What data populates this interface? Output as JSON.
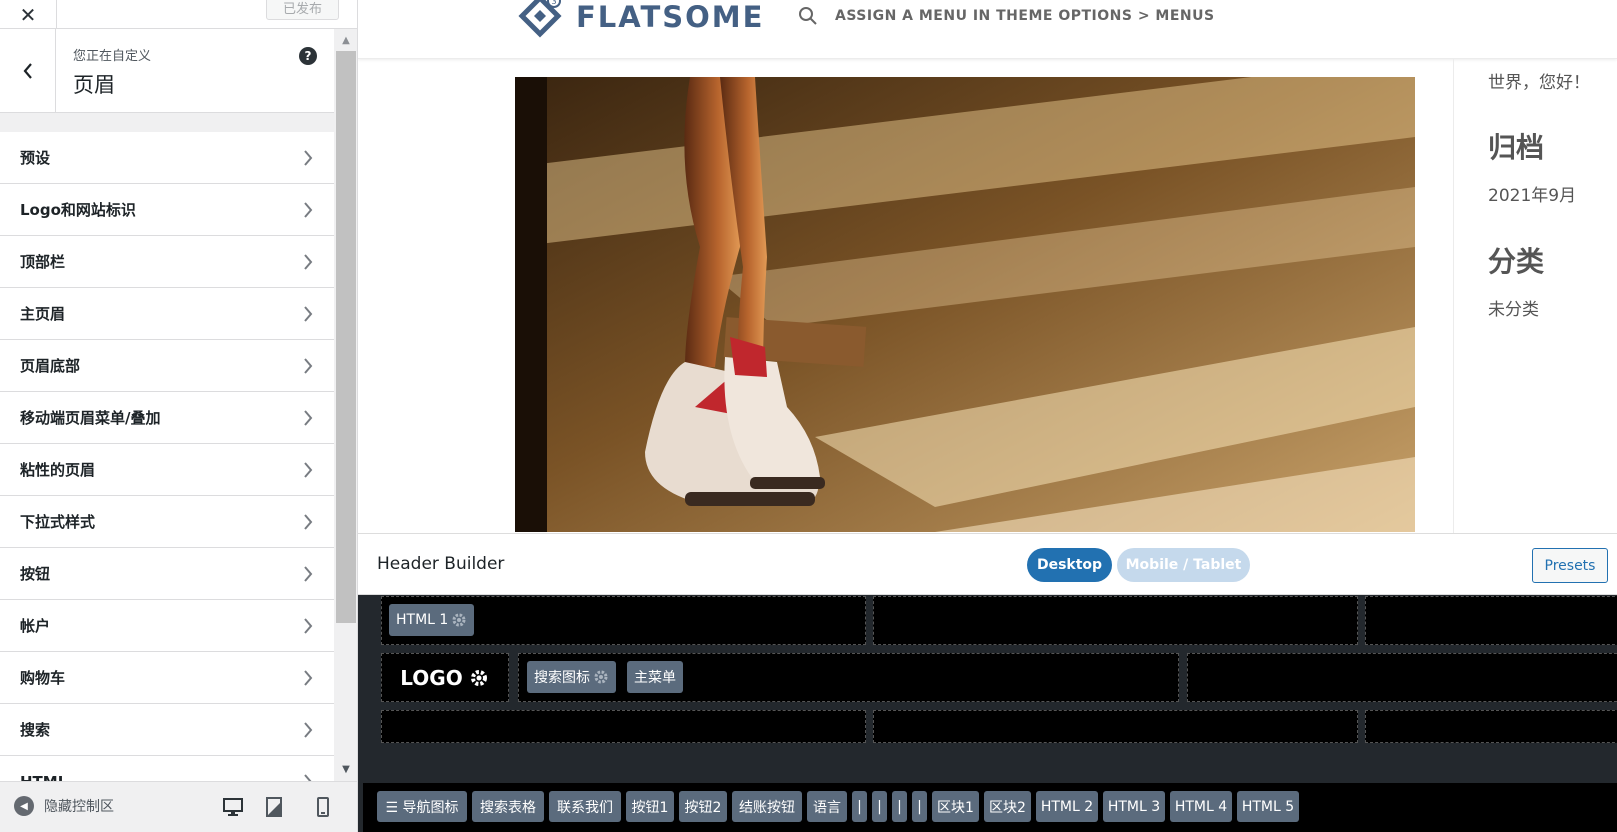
{
  "customizer": {
    "close_label": "✕",
    "publish_label": "已发布",
    "customizing_label": "您正在自定义",
    "section_title": "页眉",
    "help_label": "?",
    "menu_items": [
      {
        "label": "预设"
      },
      {
        "label": "Logo和网站标识"
      },
      {
        "label": "顶部栏"
      },
      {
        "label": "主页眉"
      },
      {
        "label": "页眉底部"
      },
      {
        "label": "移动端页眉菜单/叠加"
      },
      {
        "label": "粘性的页眉"
      },
      {
        "label": "下拉式样式"
      },
      {
        "label": "按钮"
      },
      {
        "label": "帐户"
      },
      {
        "label": "购物车"
      },
      {
        "label": "搜索"
      },
      {
        "label": "HTML"
      }
    ],
    "footer": {
      "hide_controls_label": "隐藏控制区",
      "devices": [
        "desktop-icon",
        "tablet-icon",
        "mobile-icon"
      ]
    }
  },
  "site": {
    "logo_text": "FLATSOME",
    "menu_note": "ASSIGN A MENU IN THEME OPTIONS > MENUS",
    "hero_image": "sneakers-legs-photo",
    "sidebar": {
      "hello": "世界，您好！",
      "archive_heading": "归档",
      "archive_item": "2021年9月",
      "category_heading": "分类",
      "category_item": "未分类"
    }
  },
  "header_builder": {
    "title": "Header Builder",
    "desktop_label": "Desktop",
    "mobile_label": "Mobile / Tablet",
    "presets_label": "Presets",
    "html1_label": "HTML 1",
    "logo_label": "LOGO",
    "search_icon_label": "搜索图标",
    "main_menu_label": "主菜单",
    "available_elements": [
      {
        "label": "☰ 导航图标"
      },
      {
        "label": "搜索表格"
      },
      {
        "label": "联系我们"
      },
      {
        "label": "按钮1"
      },
      {
        "label": "按钮2"
      },
      {
        "label": "结账按钮"
      },
      {
        "label": "语言"
      },
      {
        "label": "|"
      },
      {
        "label": "|"
      },
      {
        "label": "|"
      },
      {
        "label": "|"
      },
      {
        "label": "区块1"
      },
      {
        "label": "区块2"
      },
      {
        "label": "HTML 2"
      },
      {
        "label": "HTML 3"
      },
      {
        "label": "HTML 4"
      },
      {
        "label": "HTML 5"
      }
    ]
  },
  "colors": {
    "accent": "#2271b1",
    "brand": "#446084",
    "builder_dark": "#23282d",
    "tag": "#5b6b7d"
  }
}
